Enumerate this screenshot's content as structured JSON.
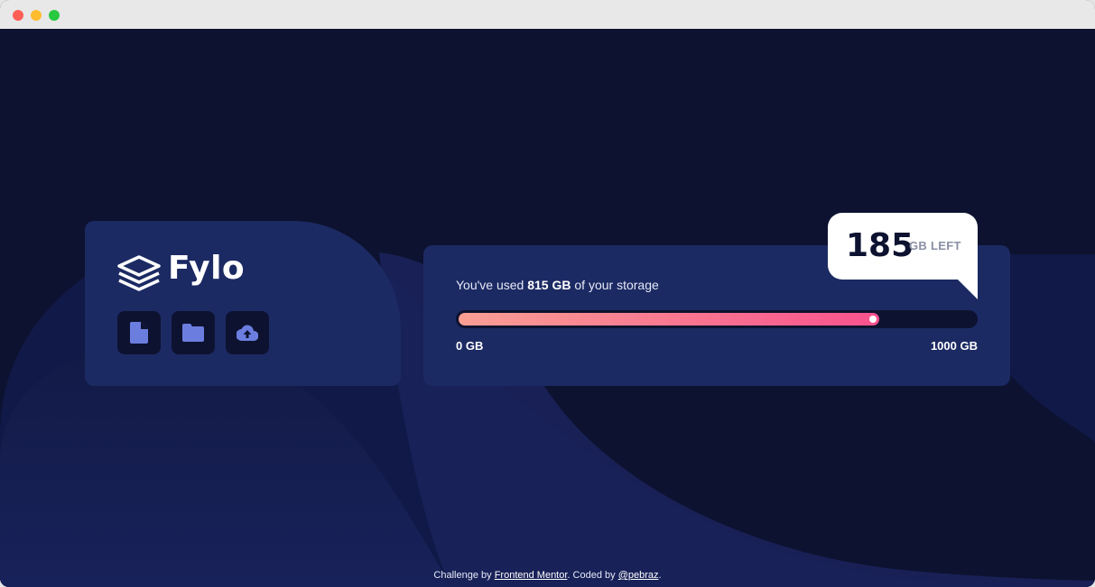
{
  "window": {
    "controls": [
      "close",
      "minimize",
      "maximize"
    ]
  },
  "brand": {
    "name": "Fylo",
    "logo_icon": "layers-icon",
    "actions": [
      {
        "name": "document-icon",
        "label": "document"
      },
      {
        "name": "folder-icon",
        "label": "folder"
      },
      {
        "name": "upload-icon",
        "label": "upload"
      }
    ]
  },
  "storage": {
    "prefix": "You've used",
    "used": "815 GB",
    "suffix": "of your storage",
    "min_label": "0 GB",
    "max_label": "1000 GB",
    "used_fraction": 0.815,
    "left_value": "185",
    "left_unit": "GB LEFT"
  },
  "footer": {
    "prefix": "Challenge by",
    "link1": "Frontend Mentor",
    "middle": ". Coded by",
    "link2": "@pebraz",
    "suffix": "."
  },
  "colors": {
    "background": "#0d1230",
    "panel": "#1c2a63",
    "accent_start": "#fa9f94",
    "accent_end": "#f8528e",
    "icon": "#6b7ee0"
  }
}
